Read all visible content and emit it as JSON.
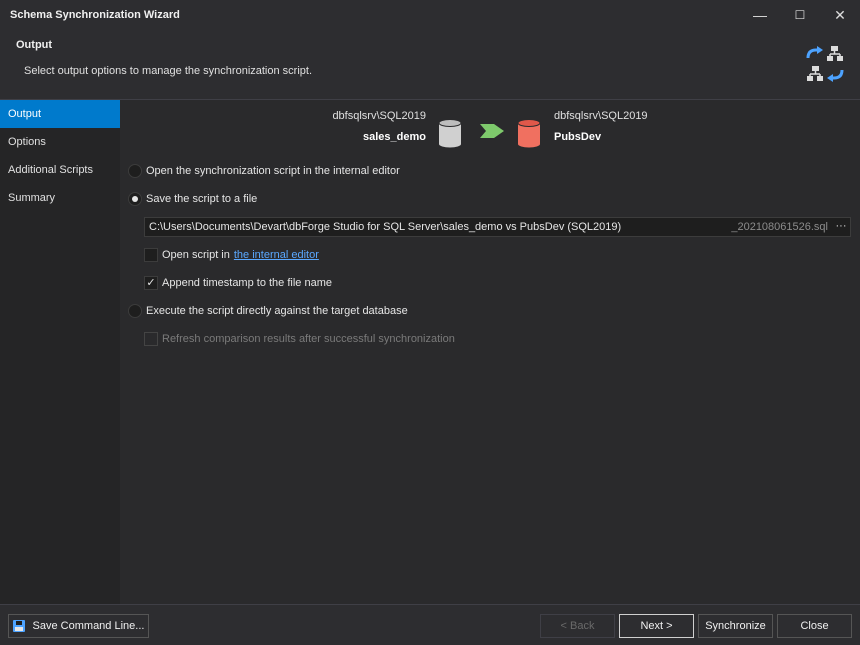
{
  "window": {
    "title": "Schema Synchronization Wizard",
    "minimize": "—",
    "maximize": "☐",
    "close": "✕"
  },
  "header": {
    "title": "Output",
    "subtitle": "Select output options to manage the synchronization script."
  },
  "sidebar": {
    "items": [
      {
        "label": "Output",
        "active": true
      },
      {
        "label": "Options"
      },
      {
        "label": "Additional Scripts"
      },
      {
        "label": "Summary"
      }
    ]
  },
  "connection": {
    "source": {
      "server": "dbfsqlsrv\\SQL2019",
      "database": "sales_demo"
    },
    "target": {
      "server": "dbfsqlsrv\\SQL2019",
      "database": "PubsDev"
    },
    "source_color": "#d0d0d0",
    "target_color": "#f07060",
    "arrow_color": "#7ec96c"
  },
  "options": {
    "open_in_editor": {
      "label": "Open the synchronization script in the internal editor",
      "selected": false
    },
    "save_to_file": {
      "label": "Save the script to a file",
      "selected": true
    },
    "file_path": "C:\\Users\\Documents\\Devart\\dbForge Studio for SQL Server\\sales_demo vs PubsDev (SQL2019)",
    "file_suffix": "_202108061526.sql",
    "browse_label": "···",
    "open_script_in": {
      "label": "Open script in",
      "link": "the internal editor",
      "checked": false
    },
    "append_timestamp": {
      "label": "Append timestamp to the file name",
      "checked": true,
      "mark": "✓"
    },
    "execute_directly": {
      "label": "Execute the script directly against the target database",
      "selected": false
    },
    "refresh_results": {
      "label": "Refresh comparison results after successful synchronization",
      "checked": false,
      "disabled": true
    }
  },
  "footer": {
    "save_command_line": "Save Command Line...",
    "back": "< Back",
    "next": "Next >",
    "synchronize": "Synchronize",
    "close": "Close"
  }
}
